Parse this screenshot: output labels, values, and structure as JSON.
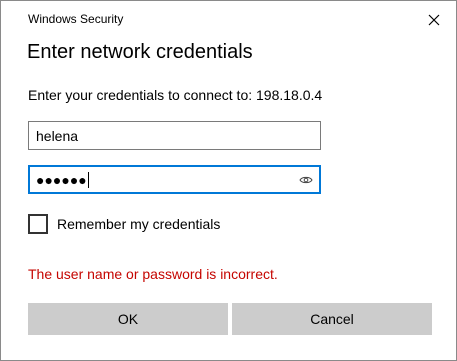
{
  "window": {
    "title": "Windows Security"
  },
  "dialog": {
    "heading": "Enter network credentials",
    "connect_text": "Enter your credentials to connect to: 198.18.0.4"
  },
  "username": {
    "value": "helena"
  },
  "password": {
    "masked_value": "●●●●●●"
  },
  "remember": {
    "label": "Remember my credentials",
    "checked": false
  },
  "error": {
    "message": "The user name or password is incorrect.",
    "color": "#c50500"
  },
  "buttons": {
    "ok_label": "OK",
    "cancel_label": "Cancel"
  },
  "icons": {
    "close": "close-icon",
    "reveal": "eye-icon"
  },
  "colors": {
    "focus_border": "#0078d7",
    "button_bg": "#cccccc"
  }
}
